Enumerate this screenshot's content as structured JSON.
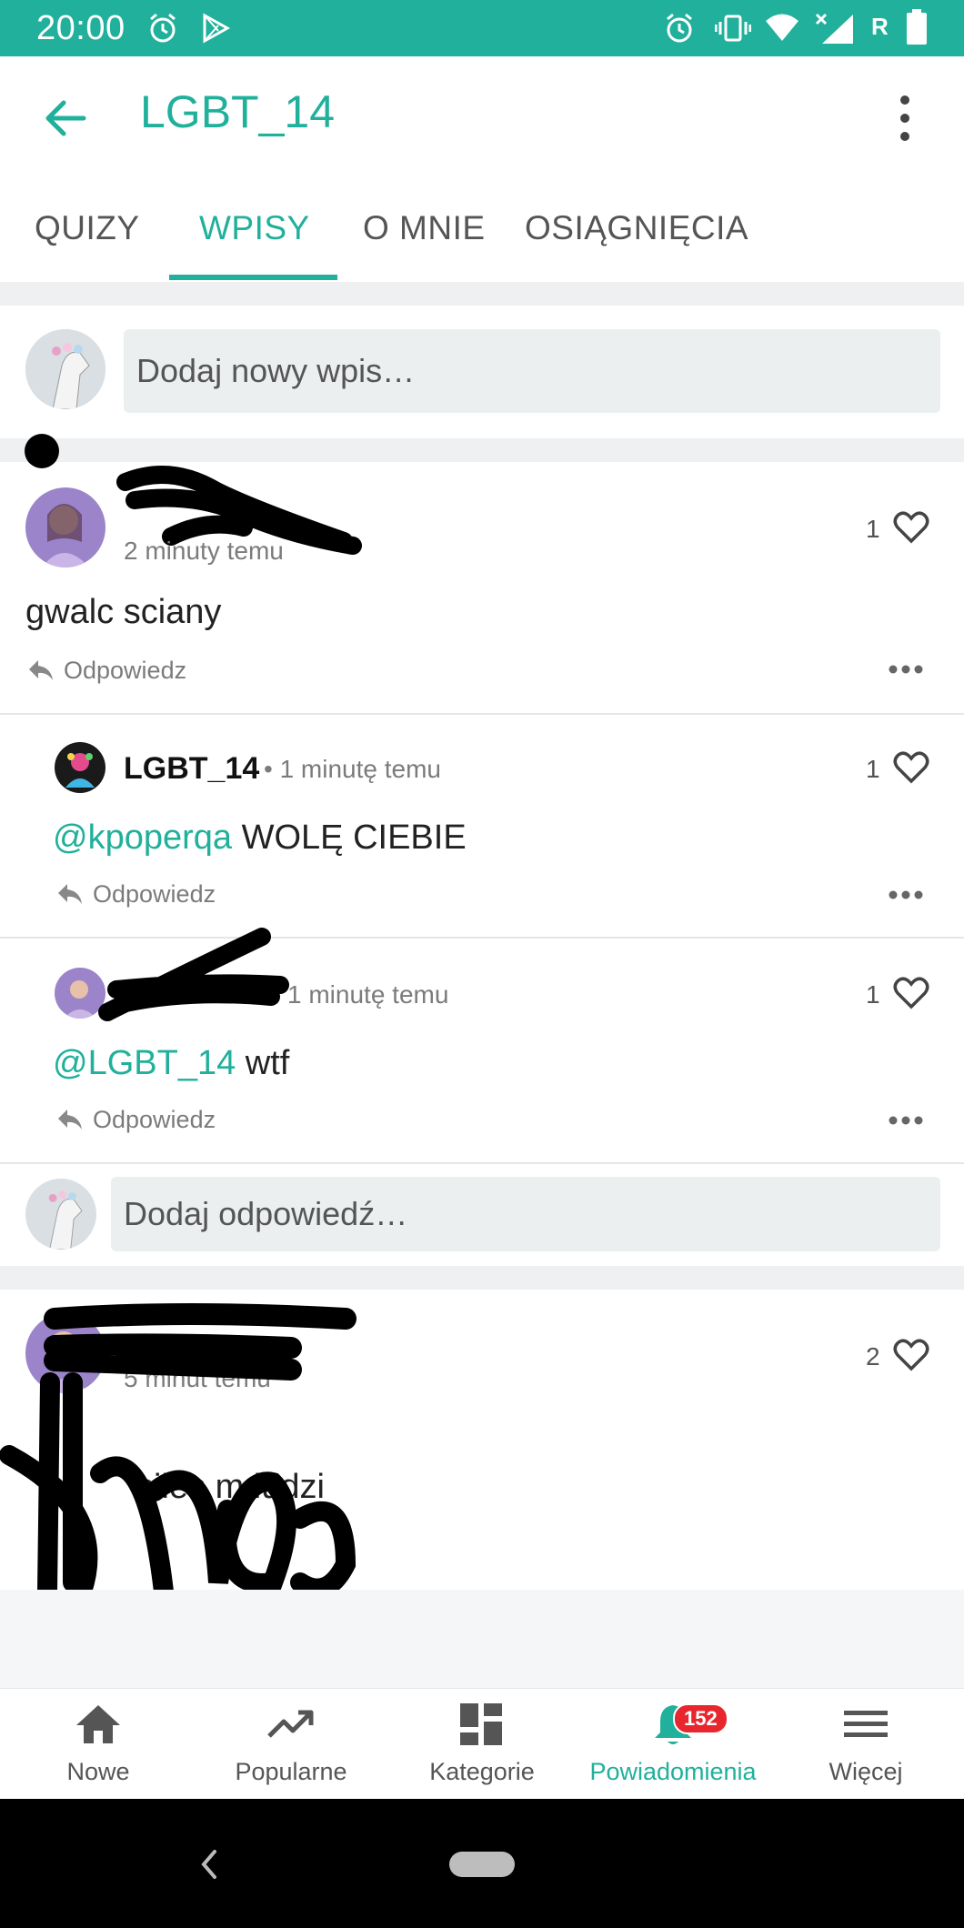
{
  "status_bar": {
    "time": "20:00",
    "network_letter": "R"
  },
  "app_bar": {
    "title": "LGBT_14"
  },
  "tabs": [
    {
      "label": "QUIZY"
    },
    {
      "label": "WPISY",
      "active": true
    },
    {
      "label": "O MNIE"
    },
    {
      "label": "OSIĄGNIĘCIA"
    }
  ],
  "compose": {
    "placeholder": "Dodaj nowy wpis…"
  },
  "post1": {
    "time": "2 minuty temu",
    "text": "gwalc sciany",
    "likes": "1",
    "reply_label": "Odpowiedz"
  },
  "reply1": {
    "username": "LGBT_14",
    "time": "• 1 minutę temu",
    "mention": "@kpoperqa",
    "text": " WOLĘ CIEBIE",
    "likes": "1",
    "reply_label": "Odpowiedz"
  },
  "reply2": {
    "time": "1 minutę temu",
    "mention": "@LGBT_14",
    "text": " wtf",
    "likes": "1",
    "reply_label": "Odpowiedz"
  },
  "reply_compose": {
    "placeholder": "Dodaj odpowiedź…"
  },
  "post2": {
    "time": "5 minut temu",
    "text_line": "ciles m ludzi",
    "likes": "2"
  },
  "bottom_nav": [
    {
      "label": "Nowe",
      "icon": "home-icon"
    },
    {
      "label": "Popularne",
      "icon": "trending-icon"
    },
    {
      "label": "Kategorie",
      "icon": "dashboard-icon"
    },
    {
      "label": "Powiadomienia",
      "icon": "bell-icon",
      "active": true,
      "badge": "152"
    },
    {
      "label": "Więcej",
      "icon": "menu-icon"
    }
  ],
  "colors": {
    "accent": "#20b09b",
    "badge": "#e8262e"
  }
}
